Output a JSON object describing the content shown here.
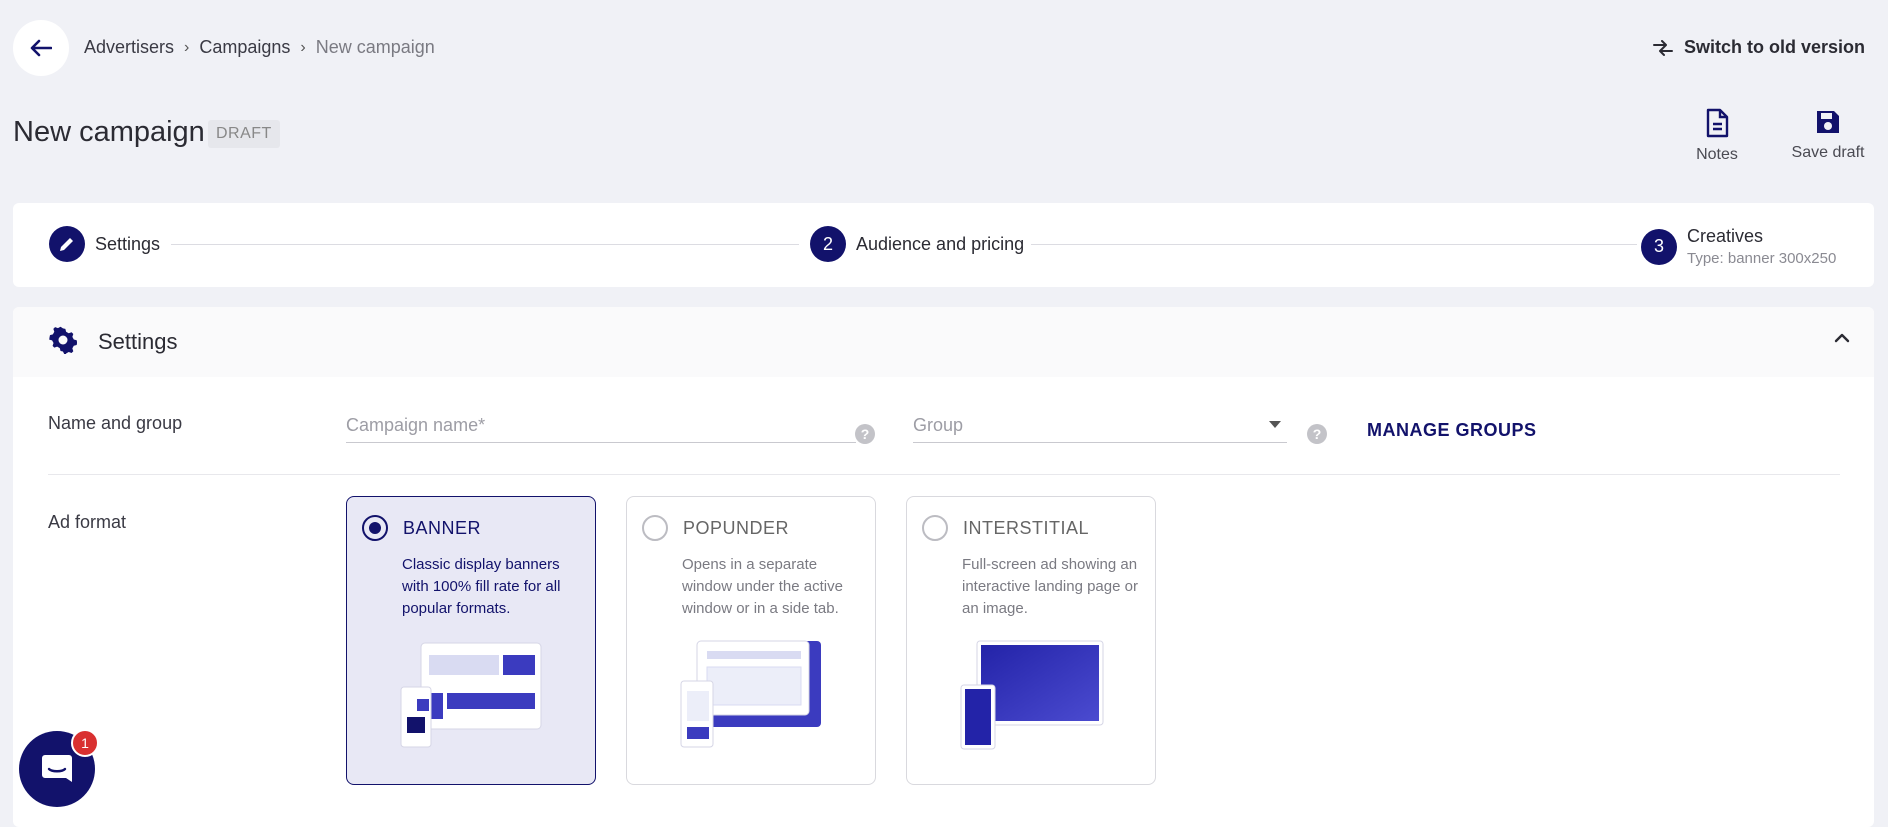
{
  "breadcrumb": {
    "items": [
      "Advertisers",
      "Campaigns"
    ],
    "current": "New campaign"
  },
  "header": {
    "switch_label": "Switch to old version",
    "title": "New campaign",
    "status": "DRAFT"
  },
  "toolbar": {
    "notes_label": "Notes",
    "save_label": "Save draft"
  },
  "steps": [
    {
      "label": "Settings",
      "icon": "pencil-icon"
    },
    {
      "number": "2",
      "label": "Audience and pricing"
    },
    {
      "number": "3",
      "label": "Creatives",
      "sub": "Type: banner 300x250"
    }
  ],
  "settings": {
    "title": "Settings",
    "name_group_label": "Name and group",
    "campaign_name_placeholder": "Campaign name*",
    "group_placeholder": "Group",
    "manage_groups": "MANAGE GROUPS",
    "ad_format_label": "Ad format",
    "formats": [
      {
        "title": "BANNER",
        "desc": "Classic display banners with 100% fill rate for all popular formats.",
        "selected": true
      },
      {
        "title": "POPUNDER",
        "desc": "Opens in a separate window under the active window or in a side tab.",
        "selected": false
      },
      {
        "title": "INTERSTITIAL",
        "desc": "Full-screen ad showing an interactive landing page or an image.",
        "selected": false
      }
    ]
  },
  "chat": {
    "badge": "1"
  },
  "colors": {
    "accent": "#12126b",
    "background": "#f0f1f6",
    "badge": "#d93030"
  }
}
